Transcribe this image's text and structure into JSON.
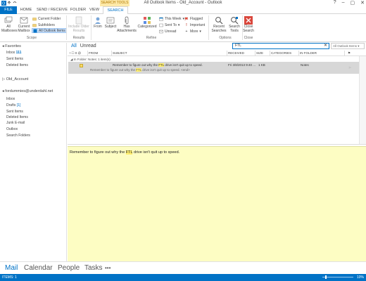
{
  "window": {
    "title": "All Outlook Items - Old_Account - Outlook",
    "context_tab_group": "SEARCH TOOLS",
    "controls": [
      "?",
      "–",
      "▢",
      "✕"
    ]
  },
  "ribbon_tabs": [
    "FILE",
    "HOME",
    "SEND / RECEIVE",
    "FOLDER",
    "VIEW",
    "SEARCH"
  ],
  "ribbon": {
    "scope": {
      "all_mailboxes": "All Mailboxes",
      "current_mailbox": "Current Mailbox",
      "current_folder": "Current Folder",
      "subfolders": "Subfolders",
      "all_outlook_items": "All Outlook Items",
      "group_label": "Scope"
    },
    "results": {
      "include_older": "Include Older Results",
      "group_label": "Results"
    },
    "refine": {
      "from": "From",
      "subject": "Subject",
      "has_attachments": "Has Attachments",
      "categorized": "Categorized",
      "this_week": "This Week",
      "sent_to": "Sent To",
      "unread": "Unread",
      "flagged": "Flagged",
      "important": "Important",
      "more": "More",
      "group_label": "Refine"
    },
    "options": {
      "recent_searches": "Recent Searches",
      "search_tools": "Search Tools",
      "group_label": "Options"
    },
    "close": {
      "close_search": "Close Search",
      "group_label": "Close"
    }
  },
  "nav": {
    "favorites_header": "Favorites",
    "favorites": [
      {
        "label": "Inbox",
        "count": "111"
      },
      {
        "label": "Sent Items",
        "count": ""
      },
      {
        "label": "Deleted Items",
        "count": ""
      }
    ],
    "account1": "Old_Account",
    "account2": "fordummies@underdahl.net",
    "account2_folders": [
      {
        "label": "Inbox",
        "count": ""
      },
      {
        "label": "Drafts",
        "count": "[1]"
      },
      {
        "label": "Sent Items",
        "count": ""
      },
      {
        "label": "Deleted Items",
        "count": ""
      },
      {
        "label": "Junk E-mail",
        "count": ""
      },
      {
        "label": "Outbox",
        "count": ""
      },
      {
        "label": "Search Folders",
        "count": ""
      }
    ]
  },
  "list": {
    "filter_all": "All",
    "filter_unread": "Unread",
    "search_value": "FTL",
    "search_scope": "All Outlook Items",
    "columns": {
      "icons": "! ☐ 0 @",
      "from": "FROM",
      "subject": "SUBJECT",
      "received": "RECEIVED",
      "size": "SIZE",
      "categories": "CATEGORIES",
      "in_folder": "IN FOLDER"
    },
    "group_header": "In Folder: Notes: 1 item(s)",
    "item": {
      "subject_pre": "Remember to figure out why the ",
      "subject_hl": "FTL",
      "subject_post": " drive isn't quit up to speed.",
      "preview_pre": "Remember to figure out why the ",
      "preview_hl": "FTL",
      "preview_post": " drive isn't quit up to speed. <end>",
      "received": "Fri 3/8/2013 9:40 ...",
      "size": "1 KB",
      "in_folder": "Notes"
    }
  },
  "reading_pane": {
    "pre": "Remember to figure out why the ",
    "hl": "FTL",
    "post": " drive isn't quit up to speed."
  },
  "bottom_nav": [
    "Mail",
    "Calendar",
    "People",
    "Tasks",
    "•••"
  ],
  "status": {
    "items": "ITEMS: 1",
    "zoom": "10%"
  },
  "colors": {
    "accent": "#0072c6",
    "note_yellow": "#fdfdc3",
    "highlight": "#ffee6e"
  }
}
